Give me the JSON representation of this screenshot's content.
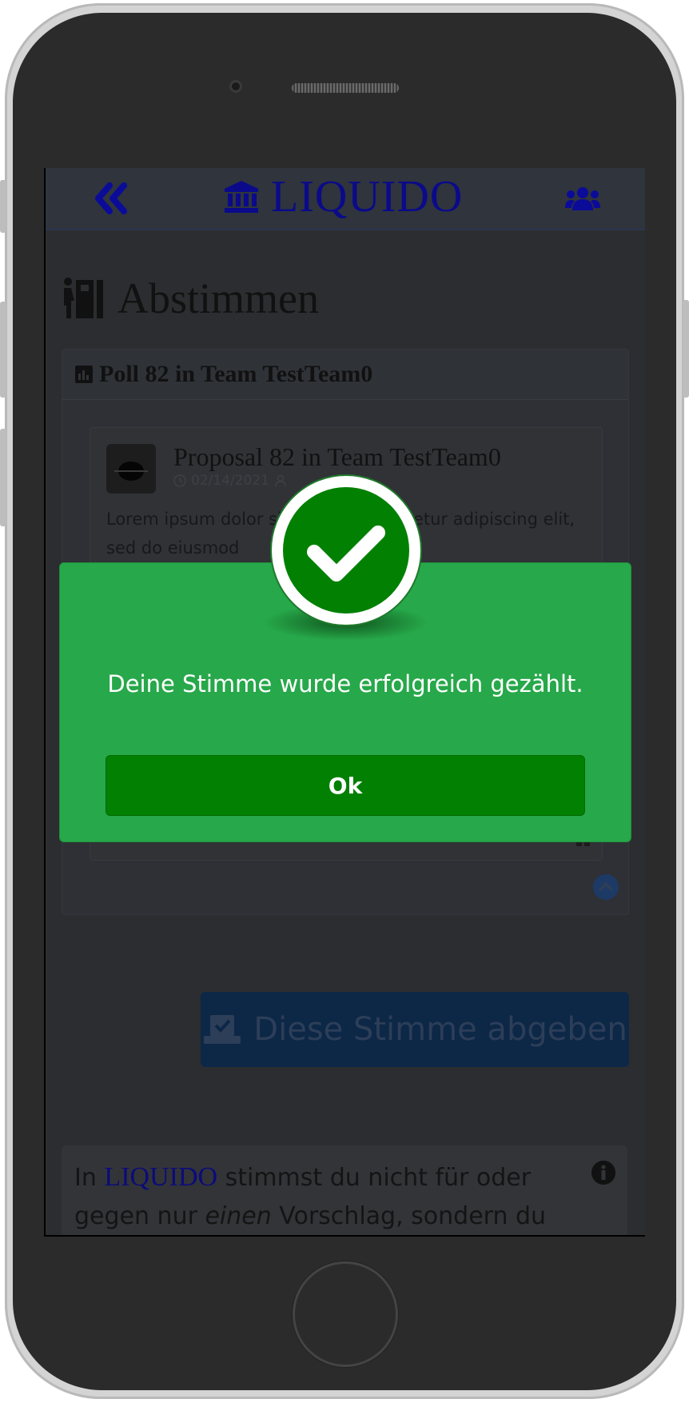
{
  "header": {
    "brand": "LIQUIDO"
  },
  "page": {
    "title": "Abstimmen"
  },
  "poll": {
    "title": "Poll 82 in Team TestTeam0",
    "proposal": {
      "title": "Proposal 82 in Team TestTeam0",
      "date": "02/14/2021",
      "description": "Lorem ipsum dolor sit amet, consectetur adipiscing elit, sed do eiusmod"
    }
  },
  "cast_button": {
    "label": "Diese Stimme abgeben"
  },
  "info": {
    "prefix": "In",
    "brand": "LIQUIDO",
    "text_1": "stimmst du nicht für oder",
    "text_2": "gegen nur",
    "emphasis": "einen",
    "text_3": "Vorschlag, sondern du"
  },
  "dialog": {
    "message": "Deine Stimme wurde erfolgreich gezählt.",
    "ok_label": "Ok",
    "icon": "check-icon"
  },
  "colors": {
    "dialog_bg": "#27a84a",
    "ok_button": "#028002",
    "brand": "#0a0a8a"
  }
}
